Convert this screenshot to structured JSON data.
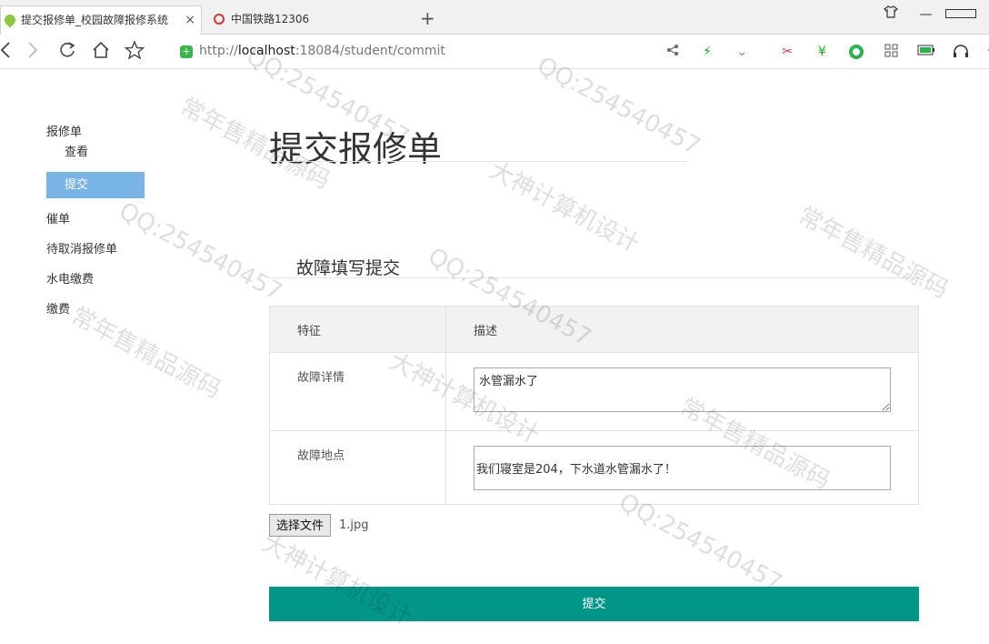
{
  "browser": {
    "tabs": [
      {
        "title": "提交报修单_校园故障报修系统",
        "close": "×"
      },
      {
        "title": "中国铁路12306"
      }
    ],
    "new_tab": "+",
    "url_host_prefix": "http://",
    "url_host": "localhost",
    "url_rest": ":18084/student/commit"
  },
  "sidebar": {
    "groups": [
      {
        "label": "报修单",
        "children": [
          "查看",
          "提交"
        ]
      },
      {
        "label": "催单"
      },
      {
        "label": "待取消报修单"
      },
      {
        "label": "水电缴费"
      },
      {
        "label": "缴费"
      }
    ],
    "active_child": "提交"
  },
  "page": {
    "title": "提交报修单",
    "section": "故障填写提交",
    "table": {
      "headers": [
        "特征",
        "描述"
      ],
      "rows": [
        {
          "label": "故障详情",
          "value": "水管漏水了"
        },
        {
          "label": "故障地点",
          "value": "我们寝室是204，下水道水管漏水了！"
        }
      ]
    },
    "file_button": "选择文件",
    "file_name": "1.jpg",
    "submit_label": "提交"
  },
  "watermarks": [
    "QQ:254540457",
    "常年售精品源码",
    "大神计算机设计",
    "QQ:254540457",
    "常年售精品源码",
    "大神计算机设计",
    "QQ:254540457",
    "常年售精品源码",
    "QQ:254540457",
    "大神计算机设计",
    "常年售精品源码",
    "QQ:254540457"
  ]
}
